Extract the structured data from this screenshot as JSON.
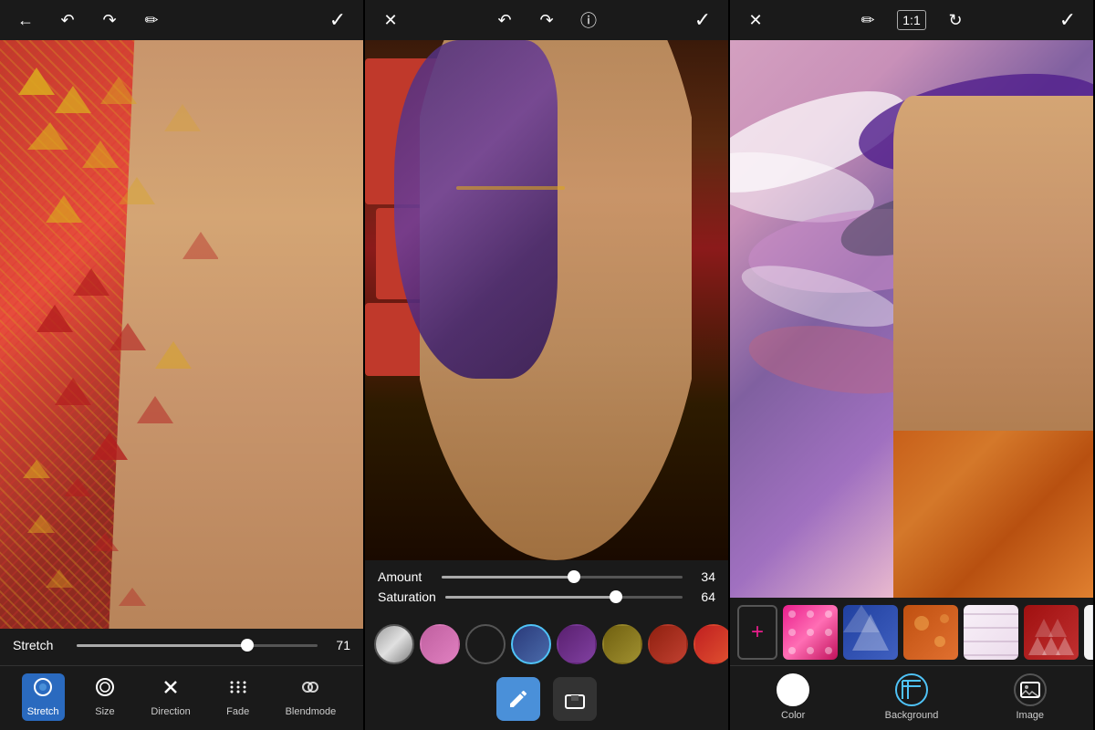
{
  "panels": [
    {
      "id": "panel1",
      "topbar": {
        "left": [
          "back-arrow",
          "undo",
          "redo",
          "eraser"
        ],
        "right": [
          "check"
        ]
      },
      "sliders": [
        {
          "label": "Stretch",
          "value": 71,
          "percent": 71
        }
      ],
      "tools": [
        {
          "id": "stretch",
          "label": "Stretch",
          "icon": "◎",
          "active": true
        },
        {
          "id": "size",
          "label": "Size",
          "icon": "◉",
          "active": false
        },
        {
          "id": "direction",
          "label": "Direction",
          "icon": "✕",
          "active": false
        },
        {
          "id": "fade",
          "label": "Fade",
          "icon": "⁞⁞",
          "active": false
        },
        {
          "id": "blendmode",
          "label": "Blendmode",
          "icon": "⊕",
          "active": false
        }
      ]
    },
    {
      "id": "panel2",
      "topbar": {
        "left": [
          "close"
        ],
        "center": [
          "undo",
          "redo",
          "info"
        ],
        "right": [
          "check"
        ]
      },
      "sliders": [
        {
          "label": "Amount",
          "value": 34,
          "percent": 55
        },
        {
          "label": "Saturation",
          "value": 64,
          "percent": 72
        }
      ],
      "swatches": [
        {
          "color": "#c0c0c0",
          "pattern": true
        },
        {
          "color": "#c070a0"
        },
        {
          "color": "#1a1a1a"
        },
        {
          "color": "#3a4a8a",
          "active": true
        },
        {
          "color": "#5a3080"
        },
        {
          "color": "#8a7830"
        },
        {
          "color": "#a04020"
        },
        {
          "color": "#c83020"
        },
        {
          "color": "#c0c0c0"
        }
      ],
      "paintTools": [
        {
          "id": "brush",
          "icon": "✏",
          "active": true
        },
        {
          "id": "eraser",
          "icon": "◻",
          "active": false
        }
      ]
    },
    {
      "id": "panel3",
      "topbar": {
        "left": [
          "close"
        ],
        "center": [
          "eraser",
          "ratio",
          "refresh"
        ],
        "right": [
          "check"
        ]
      },
      "bgThumbs": [
        {
          "color1": "#e91e8c",
          "color2": "#ff6eb4",
          "pattern": "dots"
        },
        {
          "color1": "#3060c0",
          "color2": "#5080e0",
          "pattern": "abstract"
        },
        {
          "color1": "#e08030",
          "color2": "#f0a050",
          "pattern": "floral"
        },
        {
          "color1": "#f0f0f0",
          "color2": "#e0e0e0",
          "pattern": "light"
        },
        {
          "color1": "#c02020",
          "color2": "#e04040",
          "pattern": "triangles"
        },
        {
          "color1": "#f8f8f8",
          "color2": "#e8e8e8",
          "pattern": "lines"
        }
      ],
      "bgTypes": [
        {
          "id": "color",
          "label": "Color",
          "type": "circle"
        },
        {
          "id": "background",
          "label": "Background",
          "type": "pattern"
        },
        {
          "id": "image",
          "label": "Image",
          "type": "image"
        }
      ]
    }
  ]
}
